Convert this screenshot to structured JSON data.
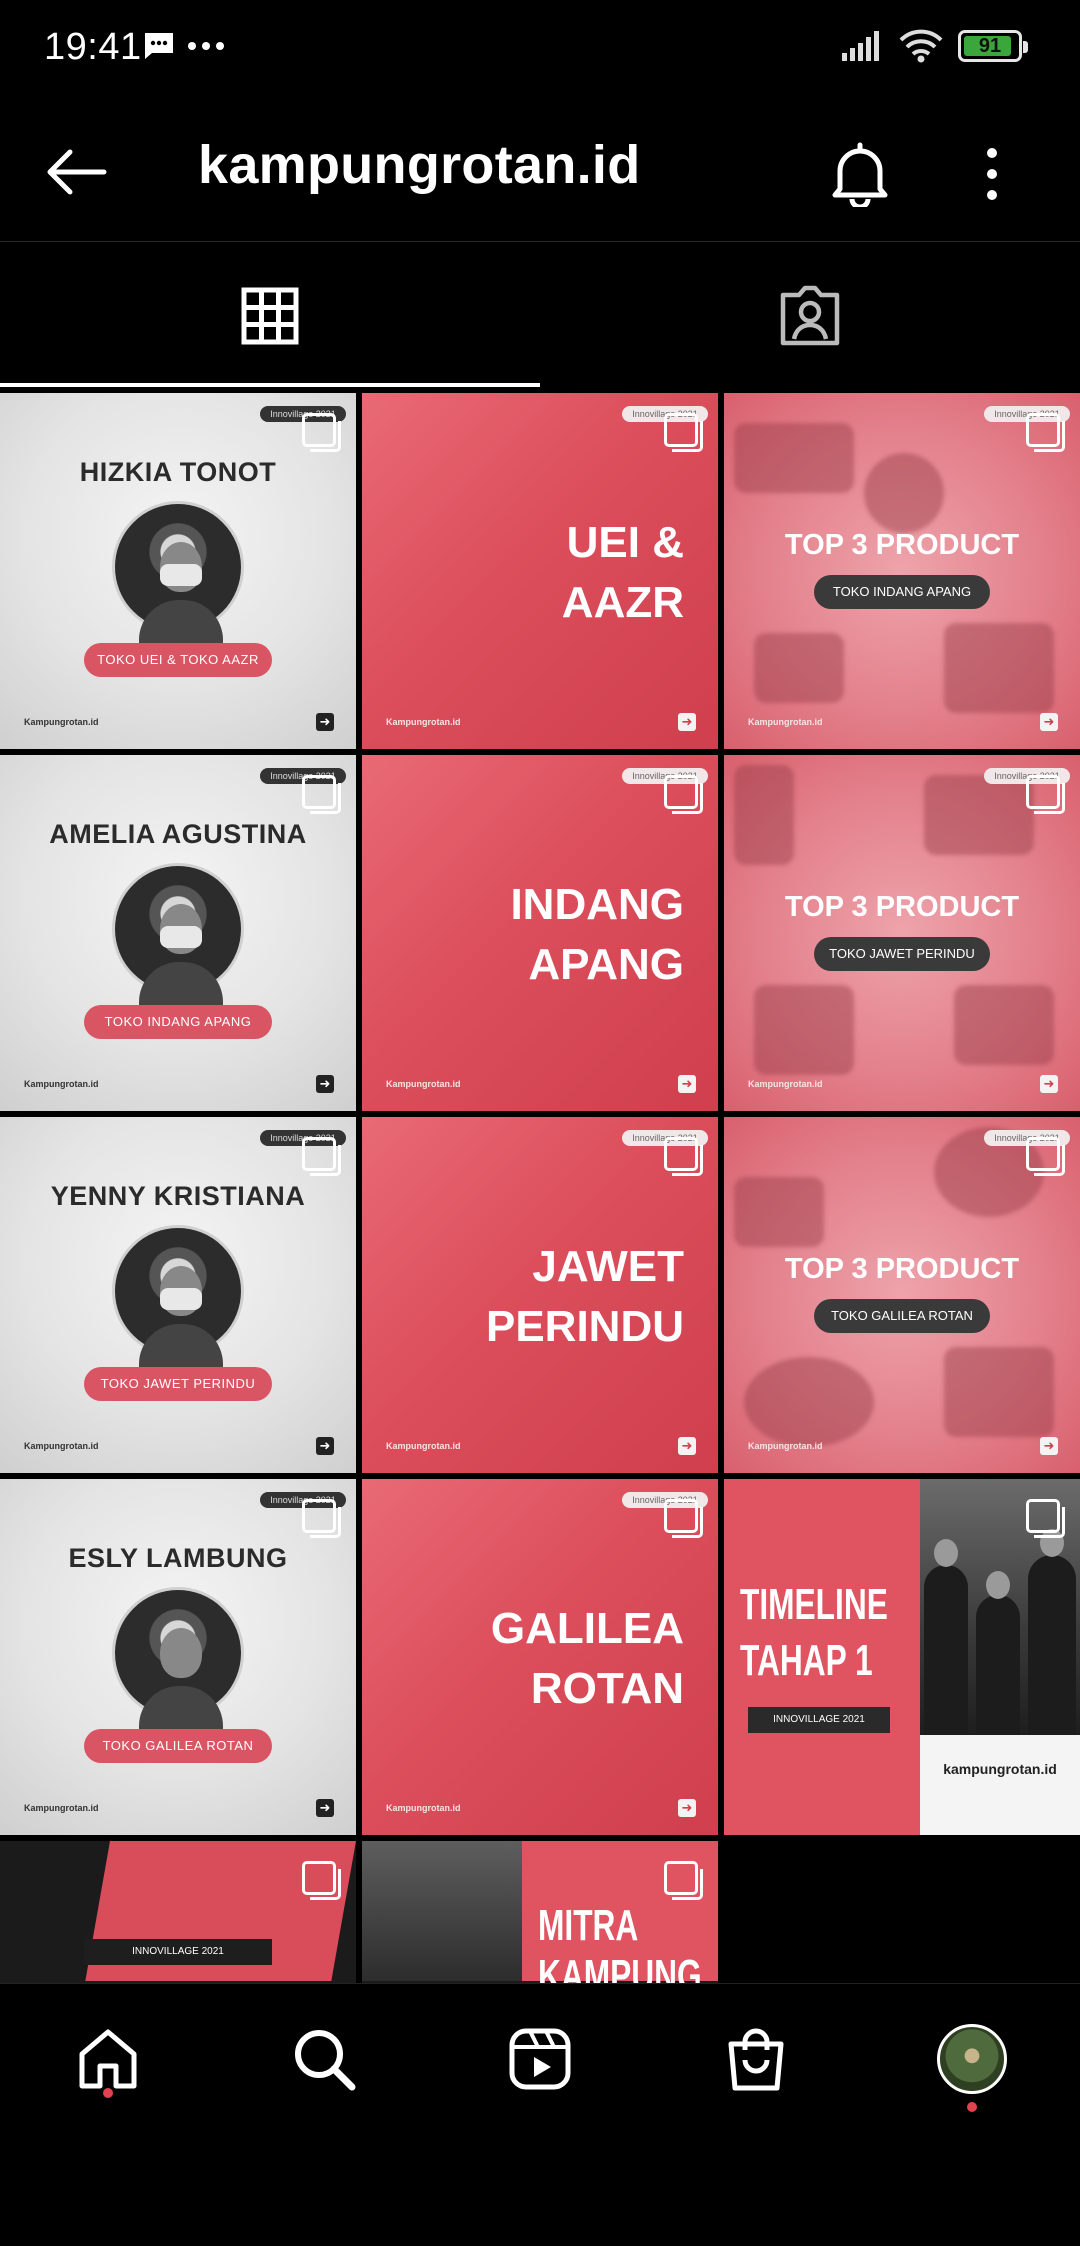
{
  "status_bar": {
    "time": "19:41",
    "battery_level": "91",
    "battery_fraction": 0.91,
    "icons": [
      "message-icon",
      "more-dots-icon",
      "signal-icon",
      "wifi-icon",
      "battery-icon"
    ]
  },
  "header": {
    "username": "kampungrotan.id",
    "icons": [
      "back-arrow-icon",
      "bell-icon",
      "more-vertical-icon"
    ]
  },
  "tabs": [
    {
      "name": "posts",
      "icon": "grid-icon",
      "active": true
    },
    {
      "name": "tagged",
      "icon": "tagged-person-icon",
      "active": false
    }
  ],
  "posts": [
    {
      "type": "profile",
      "name": "HIZKIA TONOT",
      "store": "TOKO UEI & TOKO AAZR",
      "footer": "Kampungrotan.id",
      "badge": "Innovillage 2021"
    },
    {
      "type": "red",
      "title": "UEI &\nAAZR",
      "footer": "Kampungrotan.id",
      "badge": "Innovillage 2021"
    },
    {
      "type": "product",
      "title": "TOP 3 PRODUCT",
      "store": "TOKO INDANG APANG",
      "footer": "Kampungrotan.id",
      "badge": "Innovillage 2021"
    },
    {
      "type": "profile",
      "name": "AMELIA AGUSTINA",
      "store": "TOKO INDANG APANG",
      "footer": "Kampungrotan.id",
      "badge": "Innovillage 2021"
    },
    {
      "type": "red",
      "title": "INDANG\nAPANG",
      "footer": "Kampungrotan.id",
      "badge": "Innovillage 2021"
    },
    {
      "type": "product",
      "title": "TOP 3 PRODUCT",
      "store": "TOKO JAWET PERINDU",
      "footer": "Kampungrotan.id",
      "badge": "Innovillage 2021"
    },
    {
      "type": "profile",
      "name": "YENNY KRISTIANA",
      "store": "TOKO JAWET PERINDU",
      "footer": "Kampungrotan.id",
      "badge": "Innovillage 2021"
    },
    {
      "type": "red",
      "title": "JAWET\nPERINDU",
      "footer": "Kampungrotan.id",
      "badge": "Innovillage 2021"
    },
    {
      "type": "product",
      "title": "TOP 3 PRODUCT",
      "store": "TOKO GALILEA ROTAN",
      "footer": "Kampungrotan.id",
      "badge": "Innovillage 2021"
    },
    {
      "type": "profile",
      "name": "ESLY LAMBUNG",
      "store": "TOKO GALILEA ROTAN",
      "footer": "Kampungrotan.id",
      "badge": "Innovillage 2021"
    },
    {
      "type": "red",
      "title": "GALILEA\nROTAN",
      "footer": "Kampungrotan.id",
      "badge": "Innovillage 2021"
    },
    {
      "type": "timeline",
      "title": "TIMELINE\nTAHAP 1",
      "box": "INNOVILLAGE 2021",
      "brand": "kampungrotan.id"
    },
    {
      "type": "partial-dark",
      "box": "INNOVILLAGE 2021"
    },
    {
      "type": "partial-mitra",
      "title": "MITRA\nKAMPUNG"
    }
  ],
  "bottom_nav": [
    {
      "name": "home",
      "icon": "home-icon",
      "dot": true
    },
    {
      "name": "search",
      "icon": "search-icon",
      "dot": false
    },
    {
      "name": "reels",
      "icon": "reels-icon",
      "dot": false
    },
    {
      "name": "shop",
      "icon": "shop-bag-icon",
      "dot": false
    },
    {
      "name": "profile",
      "icon": "avatar",
      "dot": true
    }
  ],
  "colors": {
    "background": "#000000",
    "brand_red": "#dc4e5b",
    "notification_dot": "#e0424f",
    "battery_green": "#3ba63b"
  }
}
